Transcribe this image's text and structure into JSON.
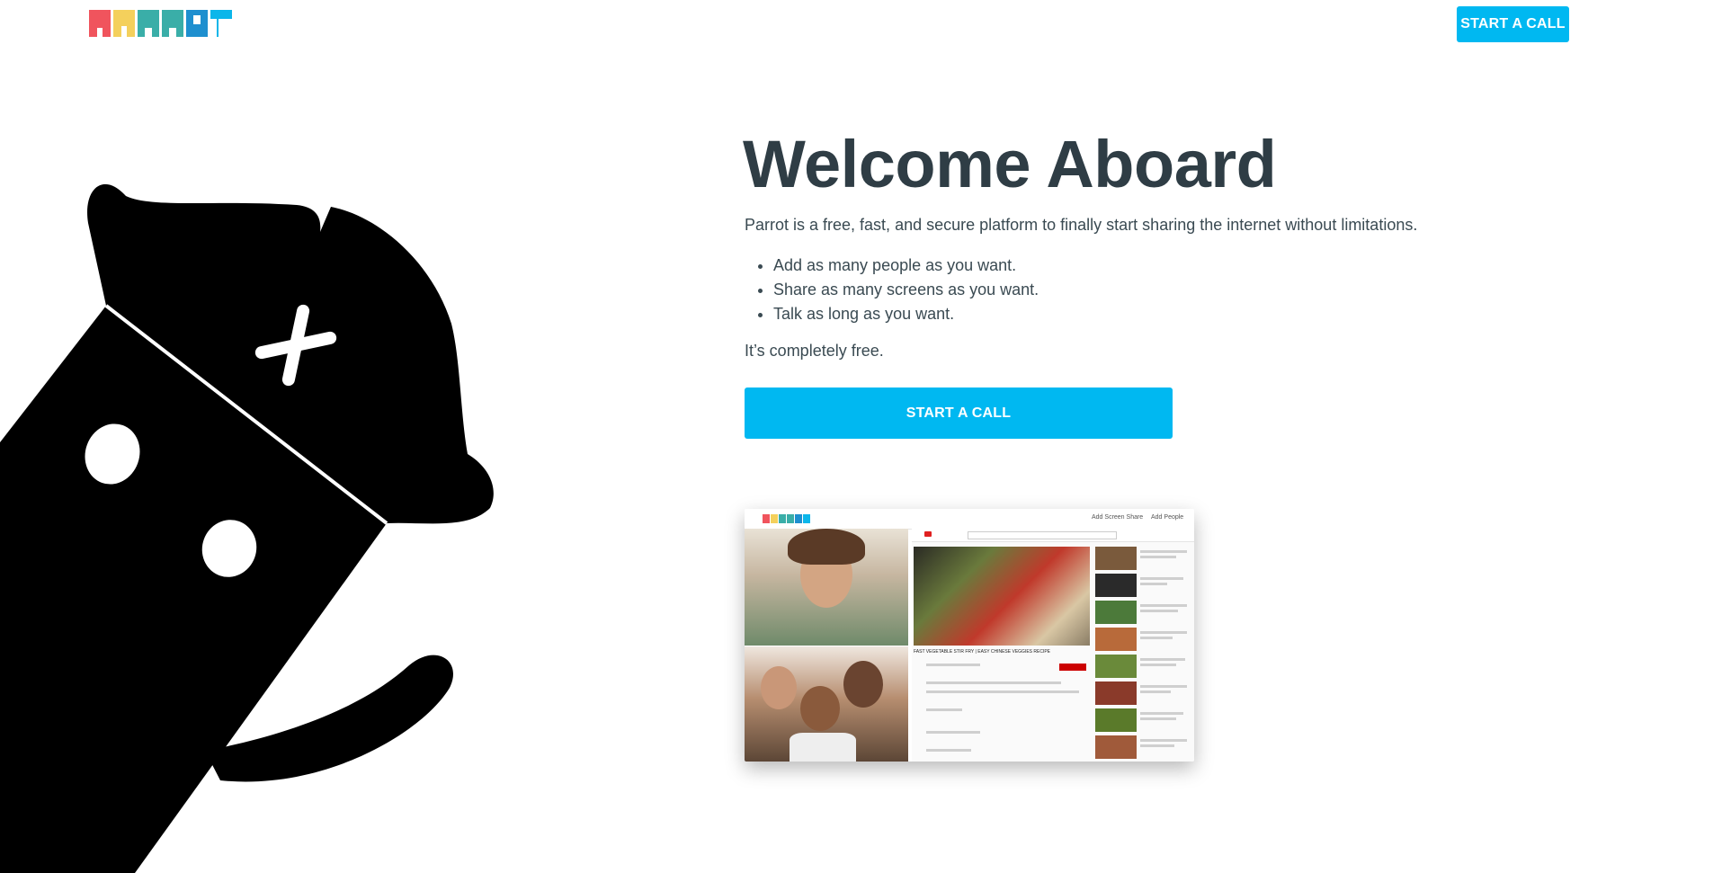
{
  "header": {
    "logo_alt": "PARROT",
    "cta_label": "START A CALL"
  },
  "hero": {
    "title": "Welcome Aboard",
    "lead": "Parrot is a free, fast, and secure platform to finally start sharing the internet without limitations.",
    "features": [
      "Add as many people as you want.",
      "Share as many screens as you want.",
      "Talk as long as you want."
    ],
    "tagline": "It’s completely free.",
    "cta_label": "START A CALL"
  },
  "preview": {
    "nav": [
      "Add Screen Share",
      "Add People"
    ],
    "video_title": "FAST VEGETABLE STIR FRY | EASY CHINESE VEGGIES RECIPE"
  },
  "colors": {
    "accent": "#00b8f1",
    "heading": "#2f3d45",
    "logo": [
      "#f0545d",
      "#f4d05c",
      "#3aaea8",
      "#1e8fcf",
      "#0bb6ea"
    ]
  },
  "icons": {
    "mascot": "parrot-mascot-icon",
    "logo": "parrot-logo-icon"
  }
}
